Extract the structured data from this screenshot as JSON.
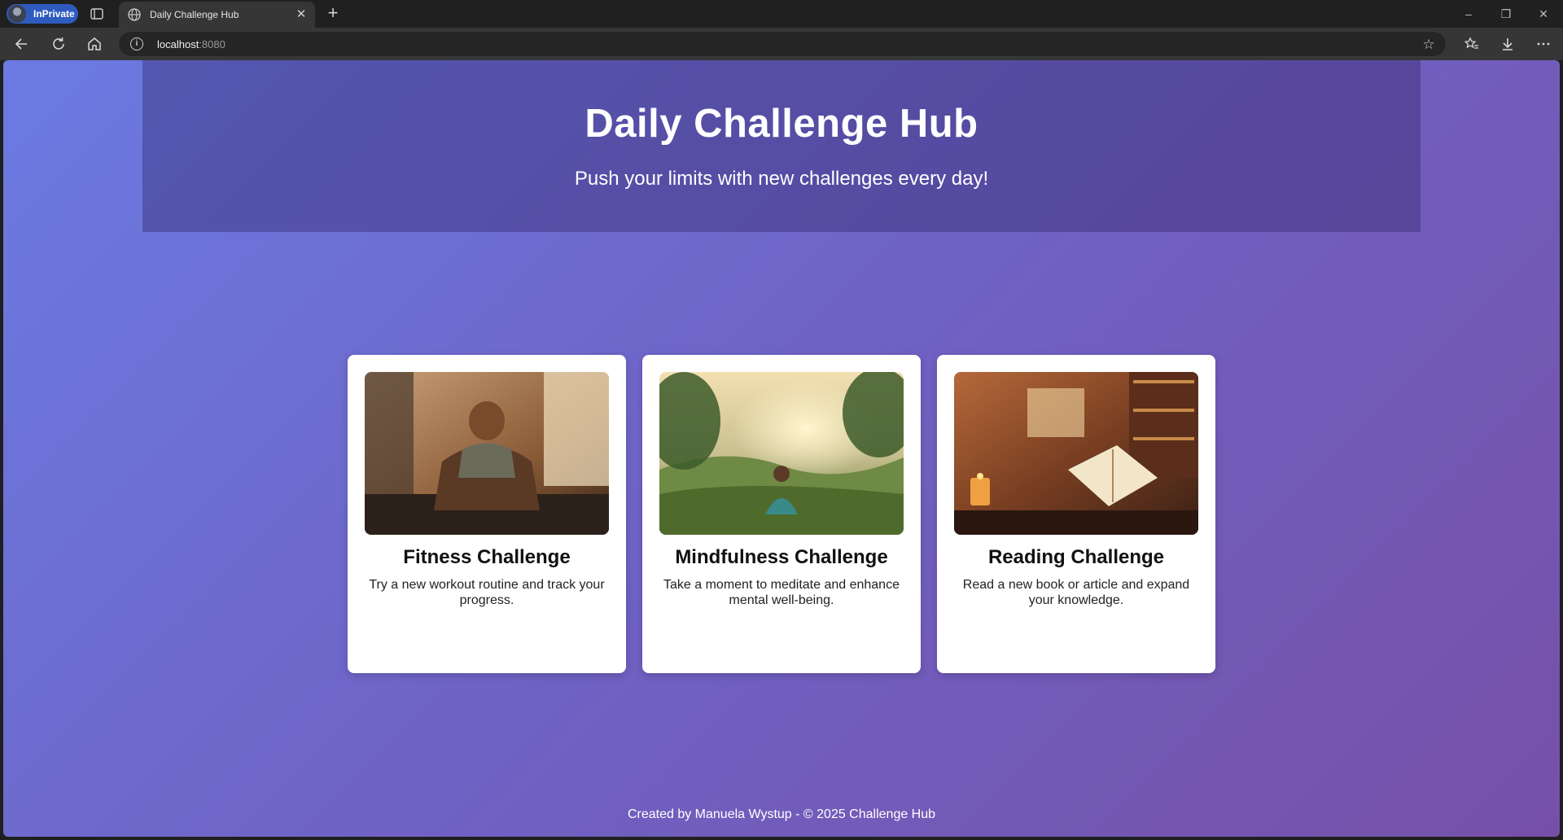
{
  "browser": {
    "profile_label": "InPrivate",
    "tab_title": "Daily Challenge Hub",
    "url_host": "localhost",
    "url_port": ":8080"
  },
  "page": {
    "hero_title": "Daily Challenge Hub",
    "hero_subtitle": "Push your limits with new challenges every day!",
    "cards": [
      {
        "title": "Fitness Challenge",
        "text": "Try a new workout routine and track your progress."
      },
      {
        "title": "Mindfulness Challenge",
        "text": "Take a moment to meditate and enhance mental well-being."
      },
      {
        "title": "Reading Challenge",
        "text": "Read a new book or article and expand your knowledge."
      }
    ],
    "footer": "Created by Manuela Wystup - © 2025 Challenge Hub"
  },
  "colors": {
    "accent_inprivate": "#2f5bbf",
    "bg_gradient_start": "#6b7be2",
    "bg_gradient_end": "#7650a8"
  }
}
